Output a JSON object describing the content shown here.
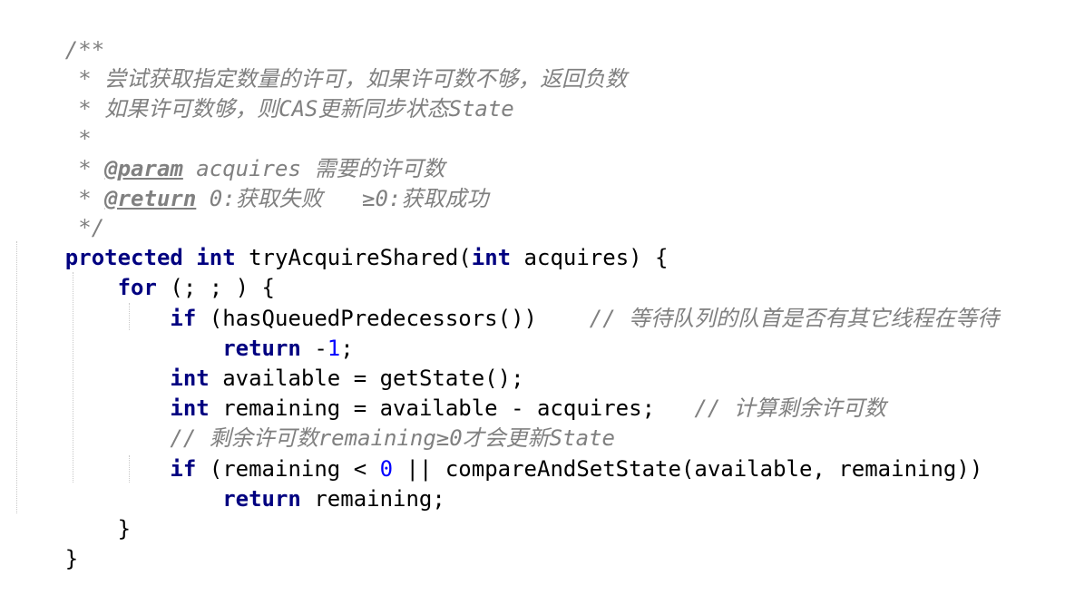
{
  "code": {
    "doc": {
      "l1": "/**",
      "l2": " * 尝试获取指定数量的许可，如果许可数不够，返回负数",
      "l3": " * 如果许可数够，则CAS更新同步状态State",
      "l4": " *",
      "l5_prefix": " * ",
      "l5_tag": "@param",
      "l5_rest": " acquires 需要的许可数",
      "l6_prefix": " * ",
      "l6_tag": "@return",
      "l6_rest": " 0:获取失败   ≥0:获取成功",
      "l7": " */"
    },
    "sig": {
      "kw1": "protected",
      "sp1": " ",
      "kw2": "int",
      "name": " tryAcquireShared(",
      "kw3": "int",
      "rest": " acquires) {"
    },
    "for_line": {
      "indent": "    ",
      "kw": "for",
      "rest": " (; ; ) {"
    },
    "if1": {
      "indent": "        ",
      "kw": "if",
      "cond": " (hasQueuedPredecessors())",
      "gap": "    ",
      "comment": "// 等待队列的队首是否有其它线程在等待"
    },
    "ret1": {
      "indent": "            ",
      "kw": "return",
      "op": " -",
      "num": "1",
      "semi": ";"
    },
    "avail": {
      "indent": "        ",
      "kw": "int",
      "rest": " available = getState();"
    },
    "remain": {
      "indent": "        ",
      "kw": "int",
      "rest": " remaining = available - acquires;",
      "gap": "   ",
      "comment": "// 计算剩余许可数"
    },
    "comment_line": {
      "indent": "        ",
      "text": "// 剩余许可数remaining≥0才会更新State"
    },
    "if2": {
      "indent": "        ",
      "kw": "if",
      "pre": " (remaining < ",
      "num": "0",
      "post": " || compareAndSetState(available, remaining))"
    },
    "ret2": {
      "indent": "            ",
      "kw": "return",
      "rest": " remaining;"
    },
    "close_for": "    }",
    "close_method": "}"
  }
}
